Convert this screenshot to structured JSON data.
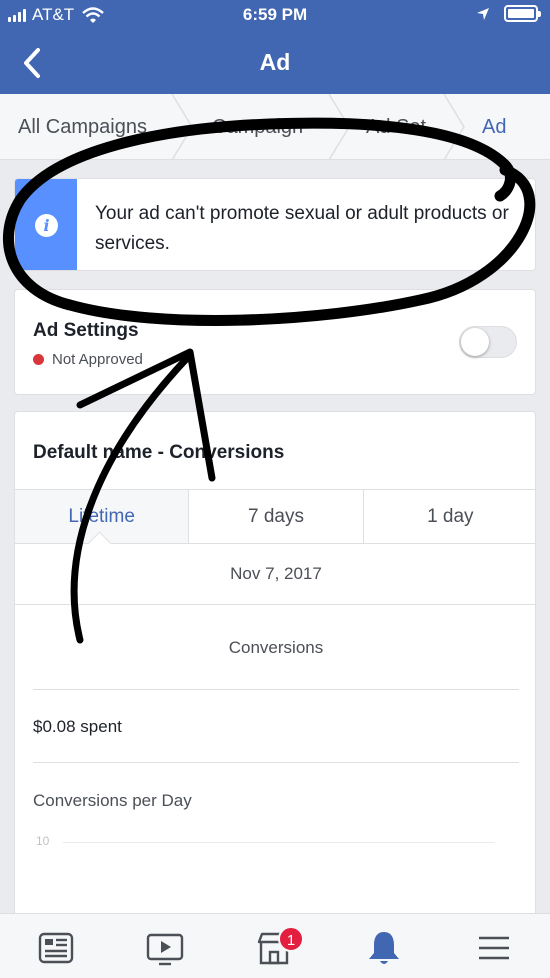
{
  "status_bar": {
    "carrier": "AT&T",
    "time": "6:59 PM"
  },
  "nav": {
    "title": "Ad"
  },
  "breadcrumb": {
    "items": [
      {
        "label": "All Campaigns"
      },
      {
        "label": "Campaign"
      },
      {
        "label": "Ad Set"
      },
      {
        "label": "Ad"
      }
    ]
  },
  "alert": {
    "message": "Your ad can't promote sexual or adult products or services."
  },
  "settings": {
    "title": "Ad Settings",
    "status": "Not Approved",
    "status_color": "#d8363a"
  },
  "performance": {
    "title": "Default name - Conversions",
    "tabs": [
      {
        "label": "Lifetime"
      },
      {
        "label": "7 days"
      },
      {
        "label": "1 day"
      }
    ],
    "date": "Nov 7, 2017",
    "metric": "Conversions",
    "spent_amount": "$0.08",
    "spent_suffix": "spent",
    "chart_title": "Conversions per Day",
    "chart_tick": "10"
  },
  "tab_bar": {
    "items": [
      {
        "icon": "news-feed-icon"
      },
      {
        "icon": "watch-icon"
      },
      {
        "icon": "marketplace-icon"
      },
      {
        "icon": "notifications-bell-icon"
      },
      {
        "icon": "menu-icon"
      }
    ],
    "badge_count": "1"
  },
  "colors": {
    "brand": "#4267b2",
    "info": "#5890ff",
    "badge": "#e41e3f"
  }
}
